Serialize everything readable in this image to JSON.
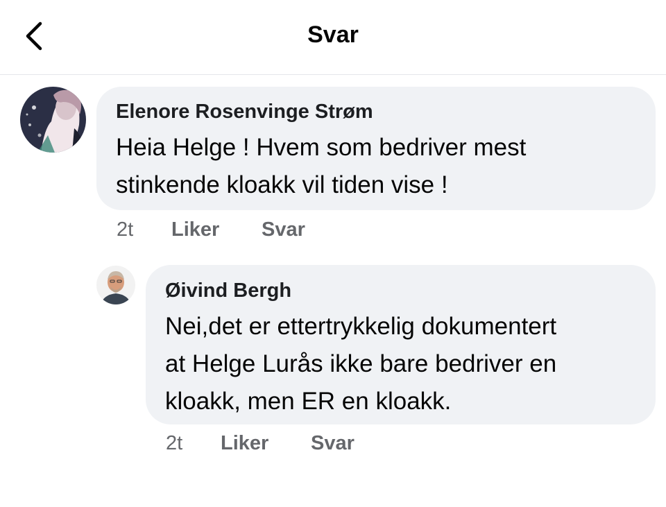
{
  "header": {
    "title": "Svar",
    "back_icon": "chevron-left-icon"
  },
  "comment": {
    "author": "Elenore Rosenvinge Strøm",
    "text_lines": [
      "Heia Helge ! Hvem som bedriver mest",
      "stinkende kloakk vil tiden vise !"
    ],
    "time": "2t",
    "like_label": "Liker",
    "reply_label": "Svar"
  },
  "reply": {
    "author": "Øivind Bergh",
    "text_lines": [
      "Nei,det er ettertrykkelig dokumentert",
      "at Helge Lurås ikke bare bedriver en",
      "kloakk, men ER en kloakk."
    ],
    "time": "2t",
    "like_label": "Liker",
    "reply_label": "Svar"
  },
  "colors": {
    "bubble": "#f0f2f5",
    "meta": "#65676b",
    "text": "#050505"
  }
}
